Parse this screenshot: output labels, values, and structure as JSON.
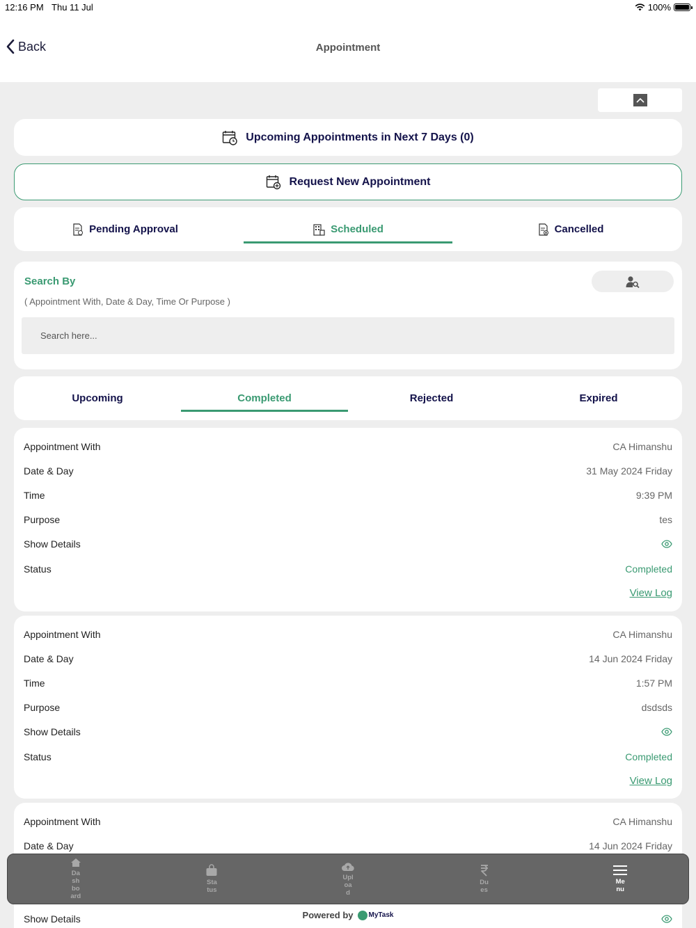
{
  "status_bar": {
    "time": "12:16 PM",
    "date": "Thu 11 Jul",
    "battery": "100%"
  },
  "nav": {
    "back_label": "Back",
    "title": "Appointment"
  },
  "upcoming_banner": {
    "label": "Upcoming Appointments in Next 7 Days (0)"
  },
  "request_button": {
    "label": "Request New Appointment"
  },
  "status_tabs": {
    "pending": "Pending Approval",
    "scheduled": "Scheduled",
    "cancelled": "Cancelled"
  },
  "search": {
    "title": "Search By",
    "hint": "( Appointment With, Date & Day, Time Or Purpose )",
    "placeholder": "Search here..."
  },
  "sub_tabs": {
    "upcoming": "Upcoming",
    "completed": "Completed",
    "rejected": "Rejected",
    "expired": "Expired"
  },
  "labels": {
    "appointment_with": "Appointment With",
    "date_day": "Date & Day",
    "time": "Time",
    "purpose": "Purpose",
    "show_details": "Show Details",
    "status": "Status",
    "view_log": "View Log"
  },
  "appointments": [
    {
      "with": "CA Himanshu",
      "date": "31 May 2024 Friday",
      "time": "9:39 PM",
      "purpose": "tes",
      "status": "Completed"
    },
    {
      "with": "CA Himanshu",
      "date": "14 Jun 2024 Friday",
      "time": "1:57 PM",
      "purpose": "dsdsds",
      "status": "Completed"
    },
    {
      "with": "CA Himanshu",
      "date": "14 Jun 2024 Friday"
    }
  ],
  "bottom_nav": {
    "dashboard": "Da\nsh\nbo\nard",
    "status": "Sta\ntus",
    "upload": "Upl\noa\nd",
    "dues": "Du\nes",
    "menu": "Me\nnu"
  },
  "footer": {
    "powered_by": "Powered by",
    "brand": "MyTask"
  },
  "colors": {
    "accent": "#3a9a72",
    "navy": "#13124a",
    "bottom_bar": "#666666"
  }
}
